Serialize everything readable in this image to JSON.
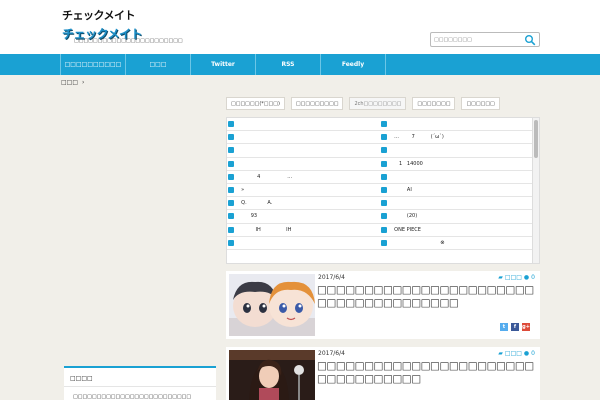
{
  "header": {
    "logo_top": "チェックメイト",
    "logo_main": "チェックメイト",
    "tagline": "□□□□□□□□□□□□□□□□□□□□□□□"
  },
  "search": {
    "placeholder": "□□□□□□□□",
    "icon": "search-icon"
  },
  "nav": {
    "items": [
      {
        "label": "□□□□□□□□□□"
      },
      {
        "label": "□□□"
      },
      {
        "label": "Twitter"
      },
      {
        "label": "RSS"
      },
      {
        "label": "Feedly"
      }
    ]
  },
  "breadcrumb": {
    "home": "□□□",
    "separator": "›"
  },
  "tabs": [
    {
      "label": "□□□□□□(*□□□)"
    },
    {
      "label": "□□□□□□□□□"
    },
    {
      "label": "2ch□□□□□□□□"
    },
    {
      "label": "□□□□□□□"
    },
    {
      "label": "□□□□□□"
    }
  ],
  "feed": {
    "left": [
      {
        "text": ""
      },
      {
        "text": ""
      },
      {
        "text": ""
      },
      {
        "text": ""
      },
      {
        "text": "            4                 ..."
      },
      {
        "text": "  »"
      },
      {
        "text": "  Q.             A."
      },
      {
        "text": "        93"
      },
      {
        "text": "           IH                IH"
      },
      {
        "text": ""
      }
    ],
    "right": [
      {
        "text": ""
      },
      {
        "text": "  ...        7          (´ω`)"
      },
      {
        "text": ""
      },
      {
        "text": "     1   14000"
      },
      {
        "text": ""
      },
      {
        "text": "          AI"
      },
      {
        "text": ""
      },
      {
        "text": "          (20)"
      },
      {
        "text": "  ONE PIECE"
      },
      {
        "text": "                               ⊗"
      }
    ]
  },
  "posts": [
    {
      "date": "2017/6/4",
      "category": "□□□",
      "comments": "0",
      "title": "□□□□□□□□□□□□□□□□□□□□□□□□□□□□□□□□□□□□□□",
      "share": [
        "t",
        "f",
        "g+"
      ]
    },
    {
      "date": "2017/6/4",
      "category": "□□□",
      "comments": "0",
      "title": "□□□□□□□□□□□□□□□□□□□□□□□□□□□□□□□□□□"
    }
  ],
  "sidebar": {
    "title": "□□□□",
    "link": "□□□□□□□□□□□□□□□□□□□□□□□□□"
  },
  "colors": {
    "accent": "#1aa1d3",
    "background": "#f1efe9"
  }
}
